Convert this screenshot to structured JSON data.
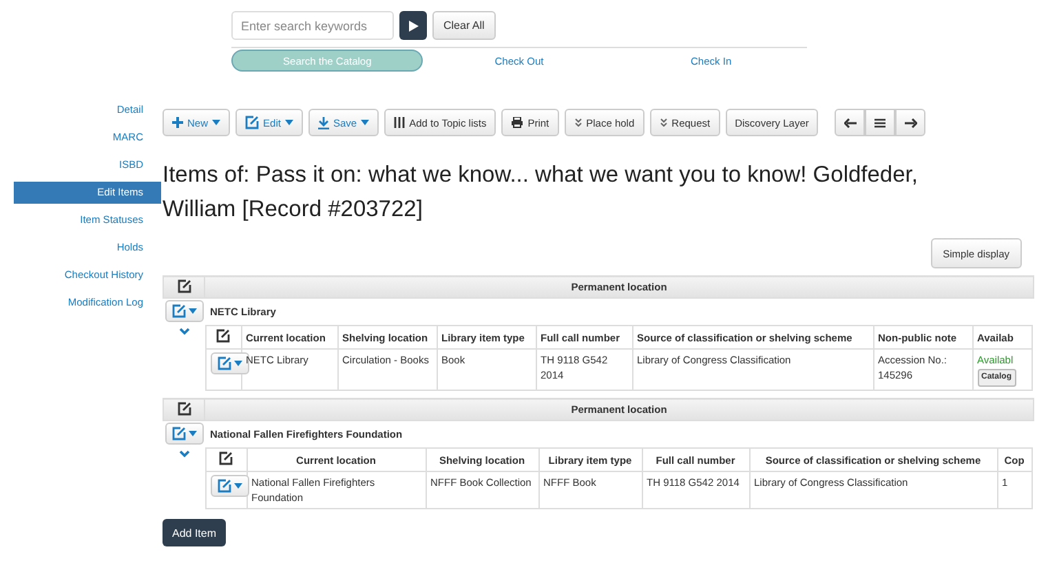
{
  "search": {
    "placeholder": "Enter search keywords",
    "clear": "Clear All"
  },
  "tabs": [
    {
      "label": "Search the Catalog",
      "selected": true
    },
    {
      "label": "Check Out",
      "selected": false
    },
    {
      "label": "Check In",
      "selected": false
    }
  ],
  "sidebar": {
    "items": [
      {
        "label": "Detail",
        "selected": false
      },
      {
        "label": "MARC",
        "selected": false
      },
      {
        "label": "ISBD",
        "selected": false
      },
      {
        "label": "Edit Items",
        "selected": true
      },
      {
        "label": "Item Statuses",
        "selected": false
      },
      {
        "label": "Holds",
        "selected": false
      },
      {
        "label": "Checkout History",
        "selected": false
      },
      {
        "label": "Modification Log",
        "selected": false
      }
    ]
  },
  "toolbar": [
    {
      "label": "New",
      "kind": "new"
    },
    {
      "label": "Edit",
      "kind": "edit"
    },
    {
      "label": "Save",
      "kind": "save"
    },
    {
      "label": "Add to Topic lists",
      "kind": "topics"
    },
    {
      "label": "Print",
      "kind": "print"
    },
    {
      "label": "Place hold",
      "kind": "hold"
    },
    {
      "label": "Request",
      "kind": "hold"
    },
    {
      "label": "Discovery Layer",
      "kind": "plain"
    }
  ],
  "title": "Items of: Pass it on: what we know... what we want you to know! Goldfeder, William [Record #203722]",
  "simple_display": "Simple display",
  "groups": [
    {
      "header": "Permanent location",
      "name": "NETC Library",
      "expanded": true,
      "columns": [
        "Current location",
        "Shelving location",
        "Library item type",
        "Full call number",
        "Source of classification or shelving scheme",
        "Non-public note",
        "Availab"
      ],
      "rows": [
        {
          "cells": [
            {
              "kind": "text",
              "text": "NETC Library"
            },
            {
              "kind": "text",
              "text": "Circulation - Books"
            },
            {
              "kind": "text",
              "text": "Book"
            },
            {
              "kind": "text",
              "text": "TH 9118 G542 2014"
            },
            {
              "kind": "text",
              "text": "Library of Congress Classification"
            },
            {
              "kind": "text",
              "text": "Accession No.: 145296"
            },
            {
              "kind": "status",
              "text": "Availabl",
              "badge": "Catalog"
            }
          ]
        }
      ]
    },
    {
      "header": "Permanent location",
      "name": "National Fallen Firefighters Foundation",
      "expanded": true,
      "columns": [
        "Current location",
        "Shelving location",
        "Library item type",
        "Full call number",
        "Source of classification or shelving scheme",
        "Cop"
      ],
      "rows": [
        {
          "cells": [
            {
              "kind": "text",
              "text": "National Fallen Firefighters Foundation"
            },
            {
              "kind": "text",
              "text": "NFFF Book Collection"
            },
            {
              "kind": "text",
              "text": "NFFF Book"
            },
            {
              "kind": "text",
              "text": "TH 9118 G542 2014"
            },
            {
              "kind": "text",
              "text": "Library of Congress Classification"
            },
            {
              "kind": "text",
              "text": "1"
            }
          ]
        }
      ]
    }
  ],
  "add_item": "Add Item"
}
